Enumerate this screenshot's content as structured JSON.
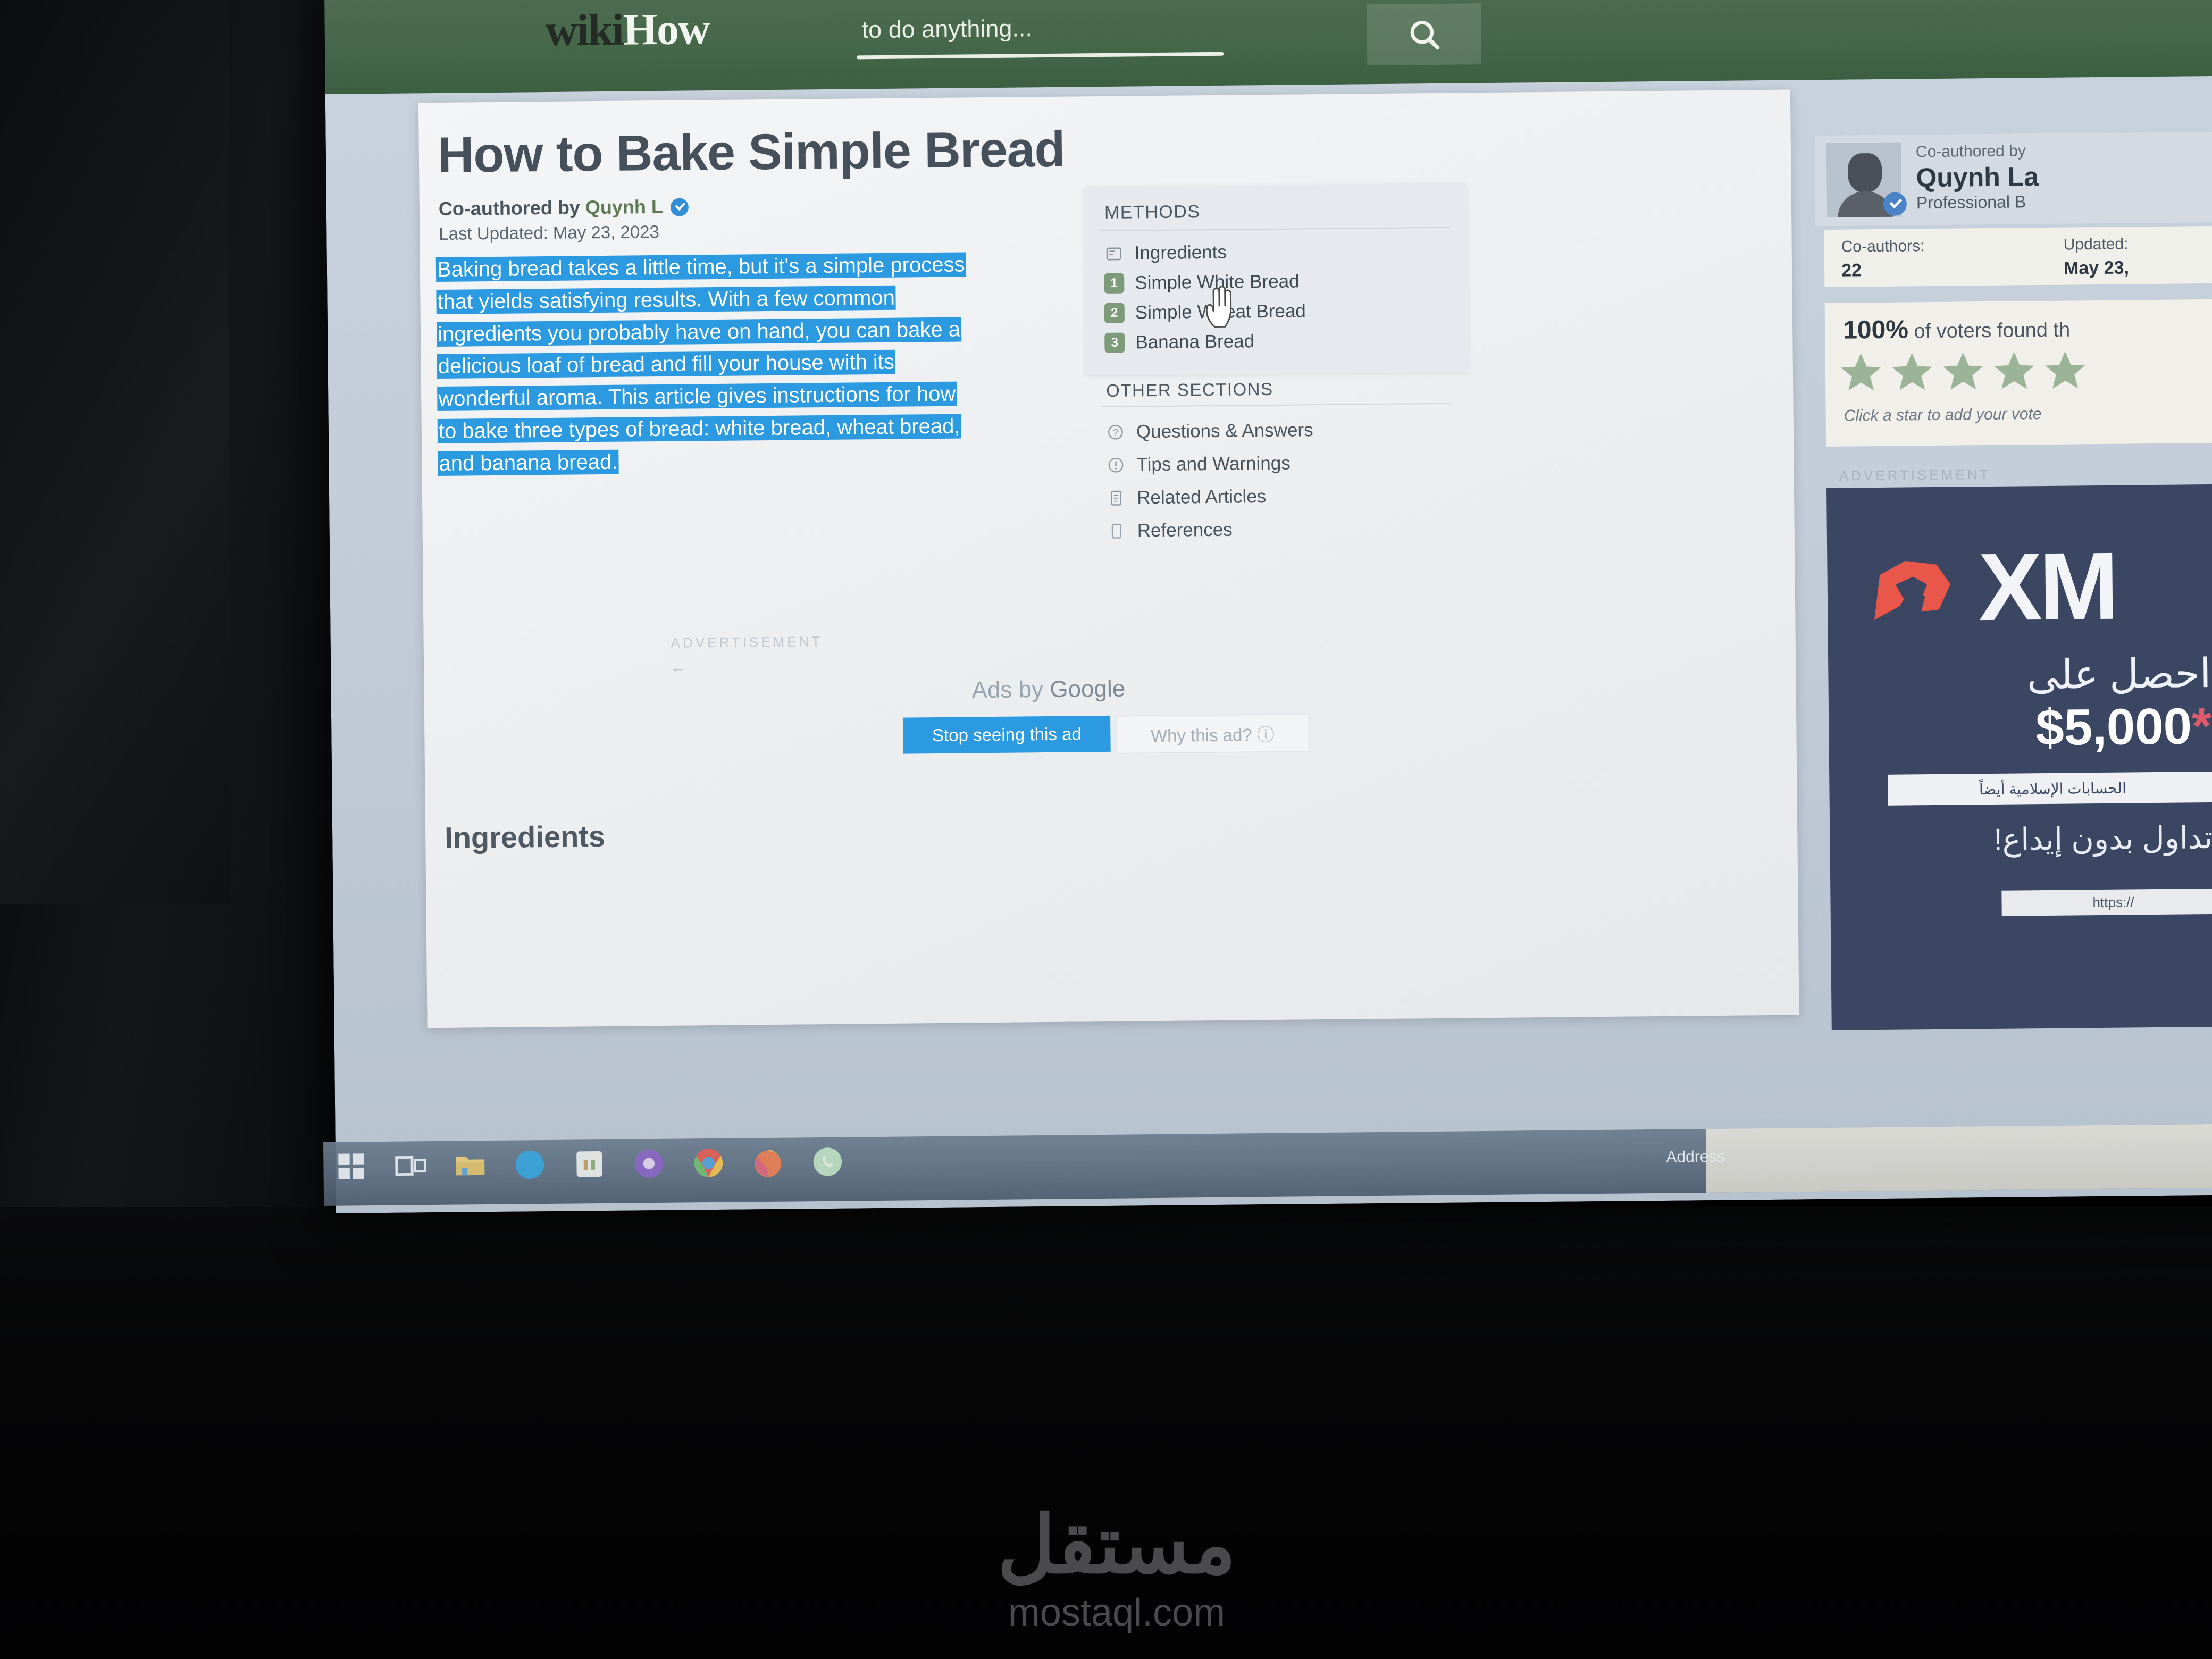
{
  "site": {
    "logo_wiki": "wiki",
    "logo_how": "How",
    "tagline": "to do anything...",
    "search_icon": "search-icon",
    "header_color": "#46684a"
  },
  "article": {
    "title": "How to Bake Simple Bread",
    "byline_prefix": "Co-authored by ",
    "byline_author": "Quynh L",
    "verified_icon": "verified-check-icon",
    "last_updated": "Last Updated: May 23, 2023",
    "intro_paragraph": "Baking bread takes a little time, but it's a simple process that yields satisfying results. With a few common ingredients you probably have on hand, you can bake a delicious loaf of bread and fill your house with its wonderful aroma. This article gives instructions for how to bake three types of bread: white bread, wheat bread, and banana bread.",
    "selection_color": "#2c9ae0",
    "section_heading": "Ingredients"
  },
  "methods_box": {
    "heading": "METHODS",
    "items": [
      {
        "badge": "",
        "icon": "ingredients-list-icon",
        "label": "Ingredients"
      },
      {
        "badge": "1",
        "icon": "",
        "label": "Simple White Bread"
      },
      {
        "badge": "2",
        "icon": "",
        "label": "Simple Wheat Bread"
      },
      {
        "badge": "3",
        "icon": "",
        "label": "Banana Bread"
      }
    ],
    "badge_color": "#7d9b78"
  },
  "other_sections": {
    "heading": "OTHER SECTIONS",
    "items": [
      {
        "icon": "question-mark-circle-icon",
        "label": "Questions & Answers"
      },
      {
        "icon": "exclamation-circle-icon",
        "label": "Tips and Warnings"
      },
      {
        "icon": "article-page-icon",
        "label": "Related Articles"
      },
      {
        "icon": "document-icon",
        "label": "References"
      }
    ]
  },
  "inline_ad": {
    "advertisement_label": "ADVERTISEMENT",
    "arrow_glyph": "←",
    "ads_by_prefix": "Ads by ",
    "ads_by_brand": "Google",
    "stop_seeing_label": "Stop seeing this ad",
    "why_this_ad_label": "Why this ad? ⓘ"
  },
  "right_rail": {
    "coauthored_label": "Co-authored by",
    "author_name": "Quynh La",
    "author_role": "Professional B",
    "stats": {
      "coauthors_label": "Co-authors:",
      "coauthors_value": "22",
      "updated_label": "Updated:",
      "updated_value": "May 23,"
    },
    "vote": {
      "percent": "100%",
      "percent_suffix": " of voters found th",
      "stars": 5,
      "star_color": "#9bb396",
      "hint": "Click a star to add your vote"
    },
    "ad": {
      "advertisement_label": "ADVERTISEMENT",
      "brand": "XM",
      "headline_ar": "احصل على",
      "amount": "$5,000",
      "amount_marker": "*",
      "cta_ar": "الحسابات الإسلامية أيضاً",
      "subline_ar": "تداول بدون إيداع!",
      "url_text": "https://",
      "bg_color": "#3b4663",
      "accent_color": "#e8574a"
    }
  },
  "taskbar": {
    "items": [
      {
        "icon": "windows-start-icon",
        "label": "Start"
      },
      {
        "icon": "task-view-icon",
        "label": "Task View"
      },
      {
        "icon": "file-explorer-icon",
        "label": "File Explorer"
      },
      {
        "icon": "blue-circle-app-icon",
        "label": "Blue App"
      },
      {
        "icon": "yellow-app-icon",
        "label": "Yellow App"
      },
      {
        "icon": "purple-app-icon",
        "label": "Purple App"
      },
      {
        "icon": "chrome-icon",
        "label": "Google Chrome"
      },
      {
        "icon": "firefox-icon",
        "label": "Mozilla Firefox"
      },
      {
        "icon": "whatsapp-icon",
        "label": "WhatsApp"
      }
    ],
    "address_label": "Address"
  },
  "watermark": {
    "arabic": "مستقل",
    "latin": "mostaql.com"
  }
}
